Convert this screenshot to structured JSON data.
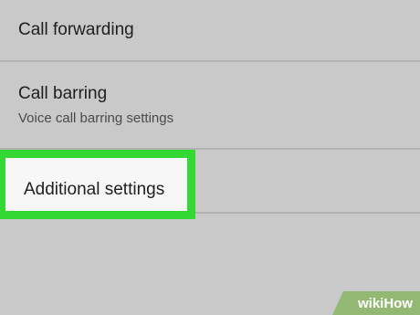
{
  "settings_list": {
    "items": [
      {
        "title": "Call forwarding"
      },
      {
        "title": "Call barring",
        "subtitle": "Voice call barring settings"
      },
      {
        "title": "Additional settings"
      }
    ]
  },
  "highlight": {
    "color": "#34d832",
    "target": "Additional settings"
  },
  "watermark": {
    "text": "wikiHow"
  }
}
